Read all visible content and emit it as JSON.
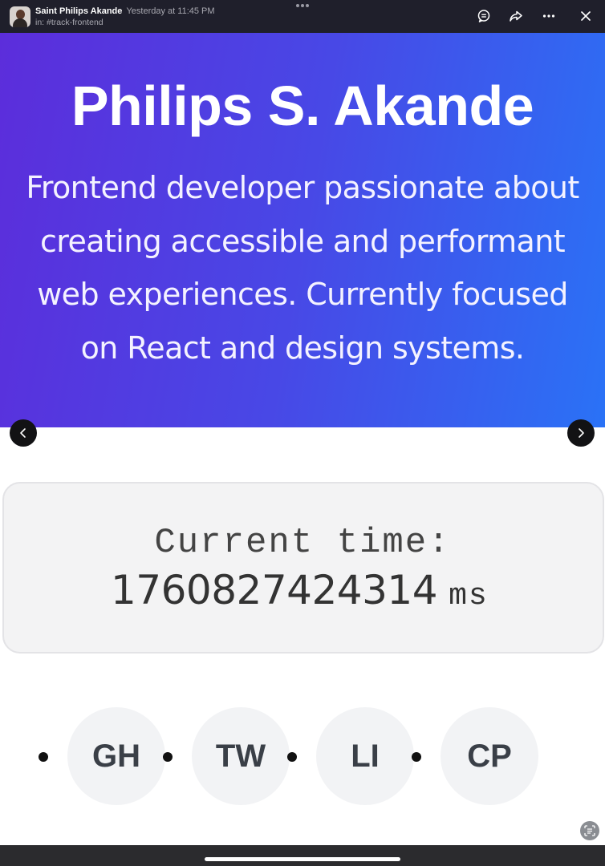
{
  "message": {
    "sender": "Saint Philips Akande",
    "timestamp": "Yesterday at 11:45 PM",
    "channel": "in: #track-frontend"
  },
  "toolbar": {
    "icons": [
      "comment-icon",
      "share-icon",
      "more-icon",
      "close-icon"
    ]
  },
  "hero": {
    "name": "Philips S. Akande",
    "bio_lines": [
      "Frontend developer passionate about",
      "creating accessible and performant",
      "web experiences. Currently focused",
      "on React and design systems."
    ],
    "gradient": [
      "#5c2ddb",
      "#2a72f6"
    ]
  },
  "carousel": {
    "prev_icon": "chevron-left-icon",
    "next_icon": "chevron-right-icon"
  },
  "time_card": {
    "label": "Current time:",
    "value": "1760827424314",
    "unit": "ms"
  },
  "social_links": [
    {
      "label": "GH"
    },
    {
      "label": "TW"
    },
    {
      "label": "LI"
    },
    {
      "label": "CP"
    }
  ]
}
